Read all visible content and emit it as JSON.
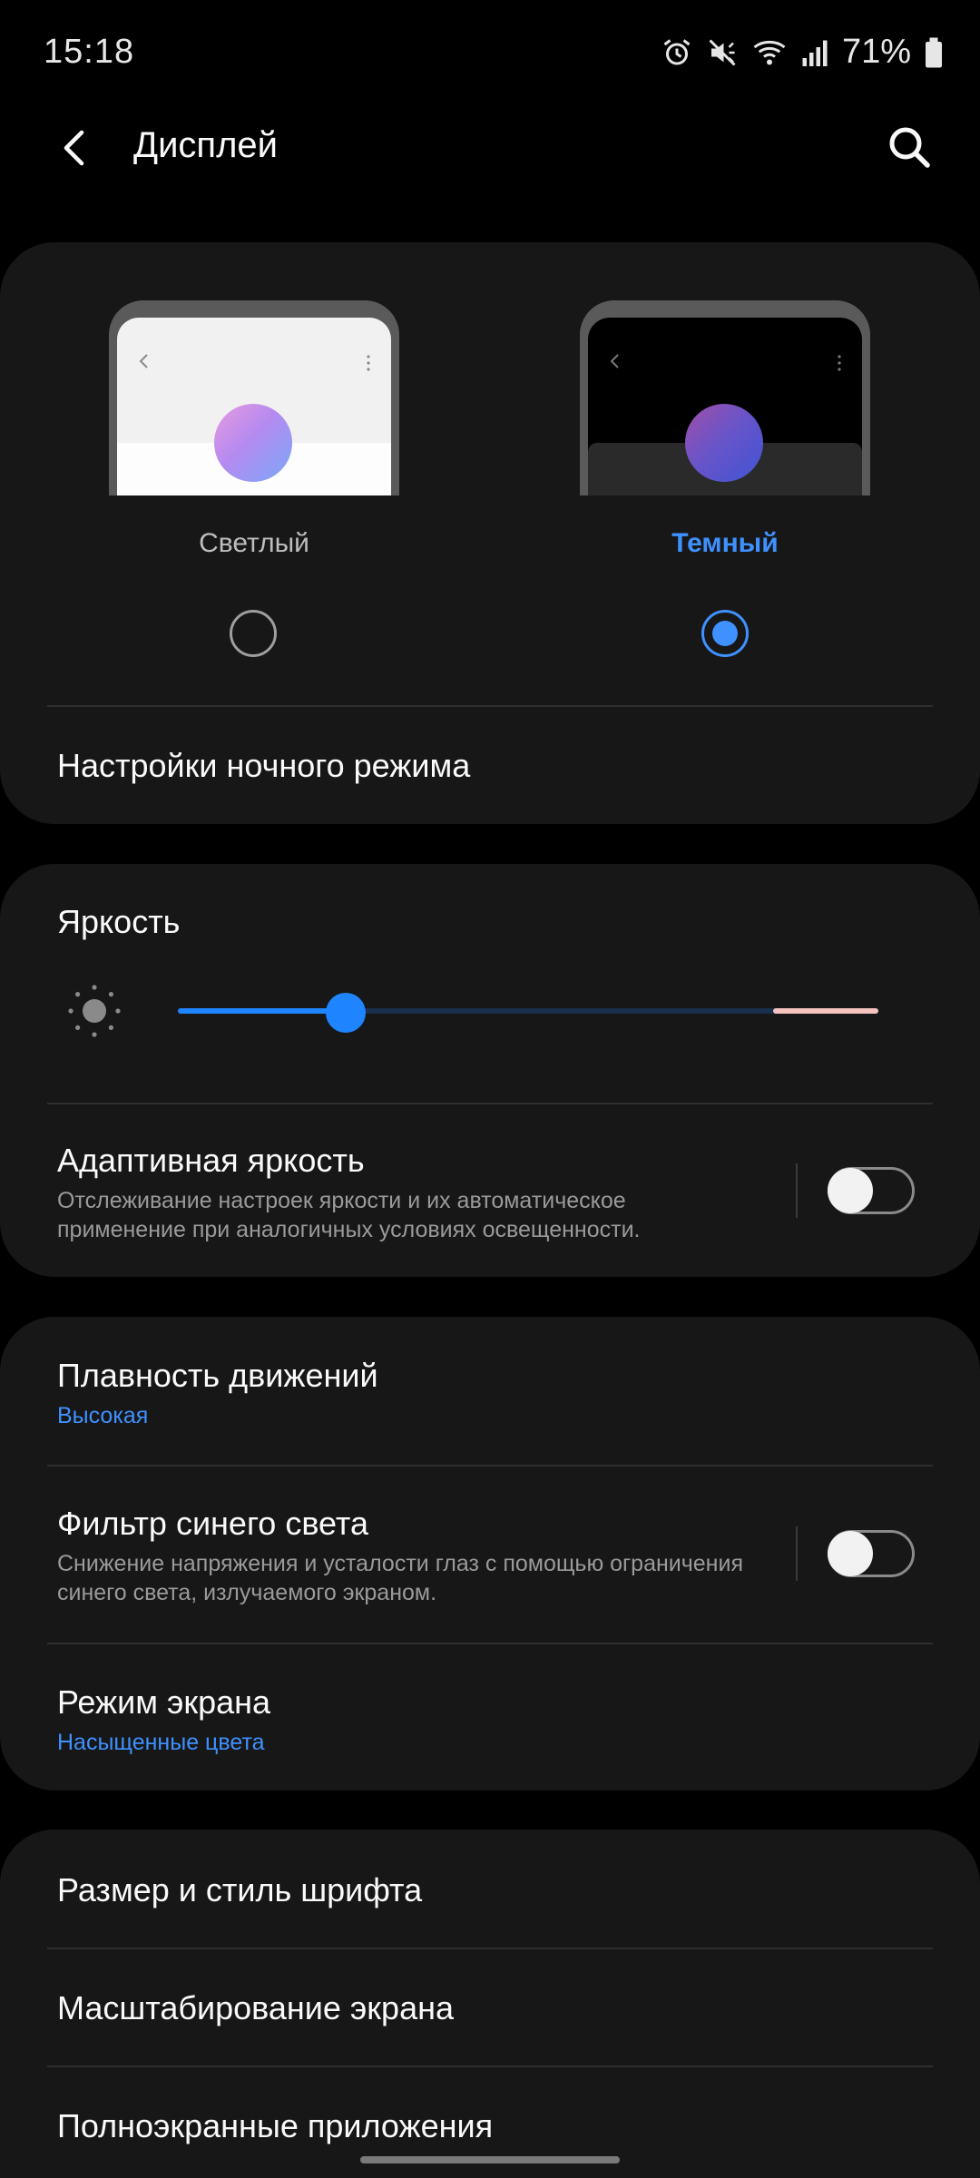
{
  "status_bar": {
    "time": "15:18",
    "battery": "71%"
  },
  "header": {
    "title": "Дисплей"
  },
  "theme": {
    "light_label": "Светлый",
    "dark_label": "Темный",
    "selected": "dark",
    "night_mode_settings": "Настройки ночного режима"
  },
  "brightness": {
    "title": "Яркость",
    "level": 0.24,
    "extra_brightness_start": 0.85,
    "adaptive": {
      "title": "Адаптивная яркость",
      "description": "Отслеживание настроек яркости и их автоматическое применение при аналогичных условиях освещенности.",
      "enabled": false
    }
  },
  "motion": {
    "title": "Плавность движений",
    "value": "Высокая"
  },
  "blue_light": {
    "title": "Фильтр синего света",
    "description": "Снижение напряжения и усталости глаз с помощью ограничения синего света, излучаемого экраном.",
    "enabled": false
  },
  "screen_mode": {
    "title": "Режим экрана",
    "value": "Насыщенные цвета"
  },
  "more": {
    "font": "Размер и стиль шрифта",
    "zoom": "Масштабирование экрана",
    "fullscreen": "Полноэкранные приложения"
  },
  "colors": {
    "accent": "#3e91ff",
    "background": "#000000",
    "card": "#171717"
  }
}
